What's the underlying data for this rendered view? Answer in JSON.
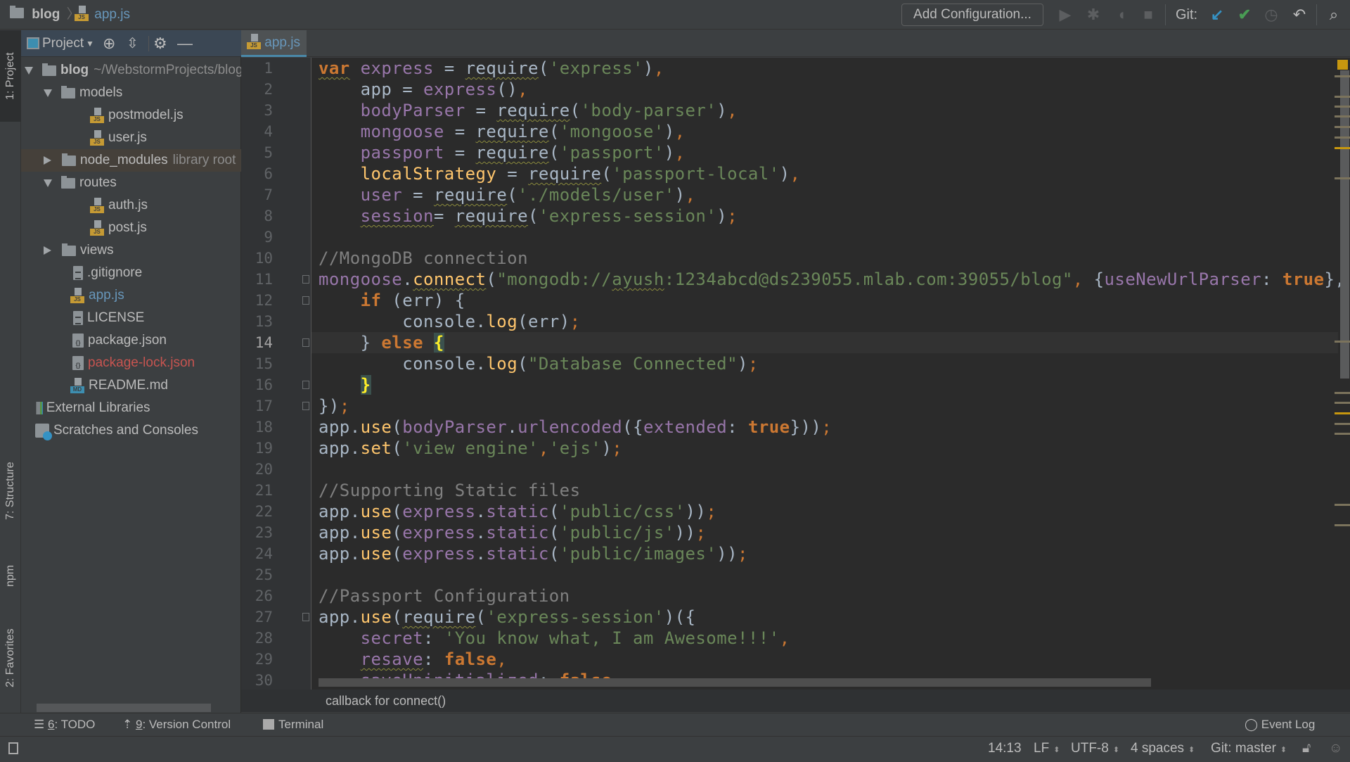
{
  "breadcrumb": {
    "project": "blog",
    "file": "app.js",
    "js_badge": "JS"
  },
  "toolbar": {
    "add_configuration": "Add Configuration...",
    "git_label": "Git:",
    "icons": [
      "run-icon",
      "debug-icon",
      "coverage-icon",
      "stop-icon",
      "git-update-icon",
      "git-commit-icon",
      "git-history-icon",
      "git-revert-icon",
      "search-icon"
    ]
  },
  "colors": {
    "git_update": "#3592c4",
    "git_commit": "#499c54",
    "keyword": "#cc7832",
    "string": "#6a8759",
    "variable": "#9876aa",
    "function": "#ffc66d",
    "comment": "#808080",
    "error_file": "#c75450",
    "modified_file": "#6897bb"
  },
  "left_stripe": {
    "project": "1: Project",
    "structure": "7: Structure",
    "npm": "npm",
    "favorites": "2: Favorites"
  },
  "project_panel": {
    "title": "Project",
    "tree": [
      {
        "label": "blog",
        "hint": "~/WebstormProjects/blog",
        "type": "folder",
        "level": 0,
        "expanded": true,
        "bold": true
      },
      {
        "label": "models",
        "type": "folder",
        "level": 1,
        "expanded": true
      },
      {
        "label": "postmodel.js",
        "type": "js",
        "level": 2
      },
      {
        "label": "user.js",
        "type": "js",
        "level": 2
      },
      {
        "label": "node_modules",
        "hint": "library root",
        "type": "folder",
        "level": 1,
        "expanded": false,
        "excluded": true
      },
      {
        "label": "routes",
        "type": "folder",
        "level": 1,
        "expanded": true
      },
      {
        "label": "auth.js",
        "type": "js",
        "level": 2
      },
      {
        "label": "post.js",
        "type": "js",
        "level": 2
      },
      {
        "label": "views",
        "type": "folder",
        "level": 1,
        "expanded": false
      },
      {
        "label": ".gitignore",
        "type": "text",
        "level": 1
      },
      {
        "label": "app.js",
        "type": "js",
        "level": 1,
        "status": "modified"
      },
      {
        "label": "LICENSE",
        "type": "text",
        "level": 1
      },
      {
        "label": "package.json",
        "type": "json",
        "level": 1
      },
      {
        "label": "package-lock.json",
        "type": "json",
        "level": 1,
        "status": "error"
      },
      {
        "label": "README.md",
        "type": "md",
        "level": 1
      },
      {
        "label": "External Libraries",
        "type": "libraries",
        "level": 0
      },
      {
        "label": "Scratches and Consoles",
        "type": "scratches",
        "level": 0
      }
    ]
  },
  "editor": {
    "tab": "app.js",
    "current_line": 14,
    "lines": [
      [
        [
          "var",
          "k u"
        ],
        [
          " "
        ],
        [
          "express",
          "v"
        ],
        [
          " = "
        ],
        [
          "require",
          "u"
        ],
        [
          "("
        ],
        [
          "'express'",
          "s"
        ],
        [
          ")"
        ],
        [
          ",",
          "o"
        ]
      ],
      [
        [
          "    app = "
        ],
        [
          "express",
          "v"
        ],
        [
          "()"
        ],
        [
          ",",
          "o"
        ]
      ],
      [
        [
          "    "
        ],
        [
          "bodyParser",
          "v"
        ],
        [
          " = "
        ],
        [
          "require",
          "u"
        ],
        [
          "("
        ],
        [
          "'body-parser'",
          "s"
        ],
        [
          ")"
        ],
        [
          ",",
          "o"
        ]
      ],
      [
        [
          "    "
        ],
        [
          "mongoose",
          "v"
        ],
        [
          " = "
        ],
        [
          "require",
          "u"
        ],
        [
          "("
        ],
        [
          "'mongoose'",
          "s"
        ],
        [
          ")"
        ],
        [
          ",",
          "o"
        ]
      ],
      [
        [
          "    "
        ],
        [
          "passport",
          "v"
        ],
        [
          " = "
        ],
        [
          "require",
          "u"
        ],
        [
          "("
        ],
        [
          "'passport'",
          "s"
        ],
        [
          ")"
        ],
        [
          ",",
          "o"
        ]
      ],
      [
        [
          "    "
        ],
        [
          "localStrategy",
          "f"
        ],
        [
          " = "
        ],
        [
          "require",
          "u"
        ],
        [
          "("
        ],
        [
          "'passport-local'",
          "s"
        ],
        [
          ")"
        ],
        [
          ",",
          "o"
        ]
      ],
      [
        [
          "    "
        ],
        [
          "user",
          "v"
        ],
        [
          " = "
        ],
        [
          "require",
          "u"
        ],
        [
          "("
        ],
        [
          "'./models/user'",
          "s"
        ],
        [
          ")"
        ],
        [
          ",",
          "o"
        ]
      ],
      [
        [
          "    "
        ],
        [
          "session",
          "v u"
        ],
        [
          "= "
        ],
        [
          "require",
          "u"
        ],
        [
          "("
        ],
        [
          "'express-session'",
          "s"
        ],
        [
          ")"
        ],
        [
          ";",
          "o"
        ]
      ],
      [],
      [
        [
          "//MongoDB connection",
          "c"
        ]
      ],
      [
        [
          "mongoose",
          "v"
        ],
        [
          "."
        ],
        [
          "connect",
          "f u"
        ],
        [
          "("
        ],
        [
          "\"mongodb://",
          "s"
        ],
        [
          "ayush",
          "s u"
        ],
        [
          ":1234abcd@ds239055.mlab.com:39055/blog\"",
          "s"
        ],
        [
          ",",
          "o"
        ],
        [
          " {"
        ],
        [
          "useNewUrlParser",
          "v"
        ],
        [
          ": "
        ],
        [
          "true",
          "k"
        ],
        [
          "},"
        ]
      ],
      [
        [
          "    "
        ],
        [
          "if",
          "k"
        ],
        [
          " (err) {"
        ]
      ],
      [
        [
          "        console."
        ],
        [
          "log",
          "f"
        ],
        [
          "(err)"
        ],
        [
          ";",
          "o"
        ]
      ],
      [
        [
          "    } "
        ],
        [
          "else",
          "k"
        ],
        [
          " "
        ],
        [
          "{",
          "b"
        ]
      ],
      [
        [
          "        console."
        ],
        [
          "log",
          "f"
        ],
        [
          "("
        ],
        [
          "\"Database Connected\"",
          "s"
        ],
        [
          ")"
        ],
        [
          ";",
          "o"
        ]
      ],
      [
        [
          "    "
        ],
        [
          "}",
          "b"
        ]
      ],
      [
        [
          "})"
        ],
        [
          ";",
          "o"
        ]
      ],
      [
        [
          "app."
        ],
        [
          "use",
          "f"
        ],
        [
          "("
        ],
        [
          "bodyParser",
          "v"
        ],
        [
          "."
        ],
        [
          "urlencoded",
          "v"
        ],
        [
          "({"
        ],
        [
          "extended",
          "v"
        ],
        [
          ": "
        ],
        [
          "true",
          "k"
        ],
        [
          "}))"
        ],
        [
          ";",
          "o"
        ]
      ],
      [
        [
          "app."
        ],
        [
          "set",
          "f"
        ],
        [
          "("
        ],
        [
          "'view engine'",
          "s"
        ],
        [
          ",",
          "o"
        ],
        [
          "'ejs'",
          "s"
        ],
        [
          ")"
        ],
        [
          ";",
          "o"
        ]
      ],
      [],
      [
        [
          "//Supporting Static files",
          "c"
        ]
      ],
      [
        [
          "app."
        ],
        [
          "use",
          "f"
        ],
        [
          "("
        ],
        [
          "express",
          "v"
        ],
        [
          "."
        ],
        [
          "static",
          "v"
        ],
        [
          "("
        ],
        [
          "'public/css'",
          "s"
        ],
        [
          "))"
        ],
        [
          ";",
          "o"
        ]
      ],
      [
        [
          "app."
        ],
        [
          "use",
          "f"
        ],
        [
          "("
        ],
        [
          "express",
          "v"
        ],
        [
          "."
        ],
        [
          "static",
          "v"
        ],
        [
          "("
        ],
        [
          "'public/js'",
          "s"
        ],
        [
          "))"
        ],
        [
          ";",
          "o"
        ]
      ],
      [
        [
          "app."
        ],
        [
          "use",
          "f"
        ],
        [
          "("
        ],
        [
          "express",
          "v"
        ],
        [
          "."
        ],
        [
          "static",
          "v"
        ],
        [
          "("
        ],
        [
          "'public/images'",
          "s"
        ],
        [
          "))"
        ],
        [
          ";",
          "o"
        ]
      ],
      [],
      [
        [
          "//Passport Configuration",
          "c"
        ]
      ],
      [
        [
          "app."
        ],
        [
          "use",
          "f"
        ],
        [
          "("
        ],
        [
          "require",
          "u"
        ],
        [
          "("
        ],
        [
          "'express-session'",
          "s"
        ],
        [
          ")({"
        ]
      ],
      [
        [
          "    "
        ],
        [
          "secret",
          "v"
        ],
        [
          ": "
        ],
        [
          "'You know what, I am Awesome!!!'",
          "s"
        ],
        [
          ",",
          "o"
        ]
      ],
      [
        [
          "    "
        ],
        [
          "resave",
          "v u"
        ],
        [
          ": "
        ],
        [
          "false",
          "k"
        ],
        [
          ",",
          "o"
        ]
      ],
      [
        [
          "    "
        ],
        [
          "saveUninitialized",
          "v"
        ],
        [
          ": "
        ],
        [
          "false",
          "k"
        ]
      ]
    ],
    "hint": "callback for connect()"
  },
  "tool_windows": {
    "todo_num": "6",
    "todo": ": TODO",
    "vcs_num": "9",
    "vcs": ": Version Control",
    "terminal": "Terminal",
    "event_log": "Event Log"
  },
  "status_bar": {
    "position": "14:13",
    "line_separator": "LF",
    "encoding": "UTF-8",
    "indent": "4 spaces",
    "branch": "Git: master"
  }
}
